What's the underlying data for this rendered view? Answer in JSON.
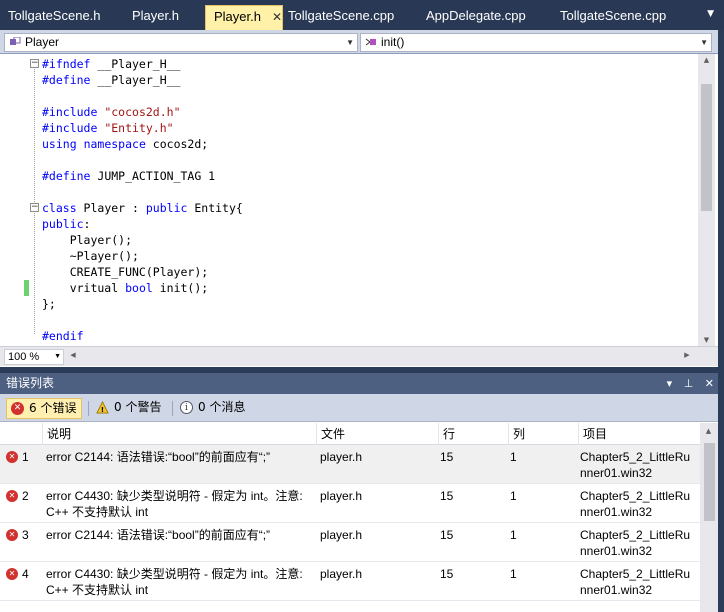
{
  "tabs": [
    {
      "label": "TollgateScene.h",
      "active": false
    },
    {
      "label": "Player.h",
      "active": false
    },
    {
      "label": "Player.h",
      "active": true
    },
    {
      "label": "TollgateScene.cpp",
      "active": false
    },
    {
      "label": "AppDelegate.cpp",
      "active": false
    },
    {
      "label": "TollgateScene.cpp",
      "active": false
    }
  ],
  "navbar": {
    "scope": "Player",
    "member": "init()"
  },
  "code": {
    "lines": [
      "#ifndef __Player_H__",
      "#define __Player_H__",
      "",
      "#include \"cocos2d.h\"",
      "#include \"Entity.h\"",
      "using namespace cocos2d;",
      "",
      "#define JUMP_ACTION_TAG 1",
      "",
      "class Player : public Entity{",
      "public:",
      "    Player();",
      "    ~Player();",
      "    CREATE_FUNC(Player);",
      "    vritual bool init();",
      "};",
      "",
      "#endif"
    ]
  },
  "zoom": "100 %",
  "error_list": {
    "title": "错误列表",
    "filters": {
      "errors": "6 个错误",
      "warnings": "0 个警告",
      "messages": "0 个消息"
    },
    "columns": [
      "说明",
      "文件",
      "行",
      "列",
      "项目"
    ],
    "rows": [
      {
        "num": "1",
        "desc1": "error C2144: 语法错误:“bool”的前面应有“;”",
        "desc2": "",
        "file": "player.h",
        "line": "15",
        "col": "1",
        "proj1": "Chapter5_2_LittleRu",
        "proj2": "nner01.win32"
      },
      {
        "num": "2",
        "desc1": "error C4430: 缺少类型说明符 - 假定为 int。注意:",
        "desc2": "C++ 不支持默认 int",
        "file": "player.h",
        "line": "15",
        "col": "1",
        "proj1": "Chapter5_2_LittleRu",
        "proj2": "nner01.win32"
      },
      {
        "num": "3",
        "desc1": "error C2144: 语法错误:“bool”的前面应有“;”",
        "desc2": "",
        "file": "player.h",
        "line": "15",
        "col": "1",
        "proj1": "Chapter5_2_LittleRu",
        "proj2": "nner01.win32"
      },
      {
        "num": "4",
        "desc1": "error C4430: 缺少类型说明符 - 假定为 int。注意:",
        "desc2": "C++ 不支持默认 int",
        "file": "player.h",
        "line": "15",
        "col": "1",
        "proj1": "Chapter5_2_LittleRu",
        "proj2": "nner01.win32"
      }
    ]
  }
}
